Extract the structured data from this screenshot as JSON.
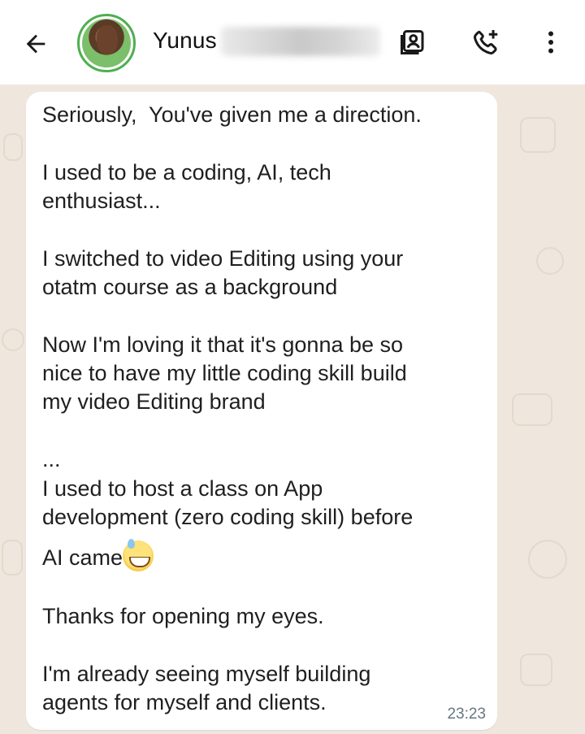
{
  "header": {
    "contact_name": "Yunus",
    "icons": {
      "back": "back-arrow-icon",
      "contact_card": "contact-card-icon",
      "add_call": "add-call-icon",
      "menu": "more-vert-icon"
    },
    "accent_color": "#4caf50"
  },
  "message": {
    "lines": [
      "Seriously,  You've given me a direction.",
      "I used to be a coding, AI, tech",
      "enthusiast...",
      "I switched to video Editing using your",
      "otatm course as a background",
      "Now I'm loving it that it's gonna be so",
      "nice to have my little coding skill build",
      "my video Editing brand",
      "...",
      "I used to host a class on App",
      "development (zero coding skill) before",
      "AI came",
      "Thanks for opening my eyes.",
      "I'm already seeing myself building",
      "agents for myself and clients."
    ],
    "emoji": "grinning-sweat-emoji",
    "timestamp": "23:23"
  }
}
